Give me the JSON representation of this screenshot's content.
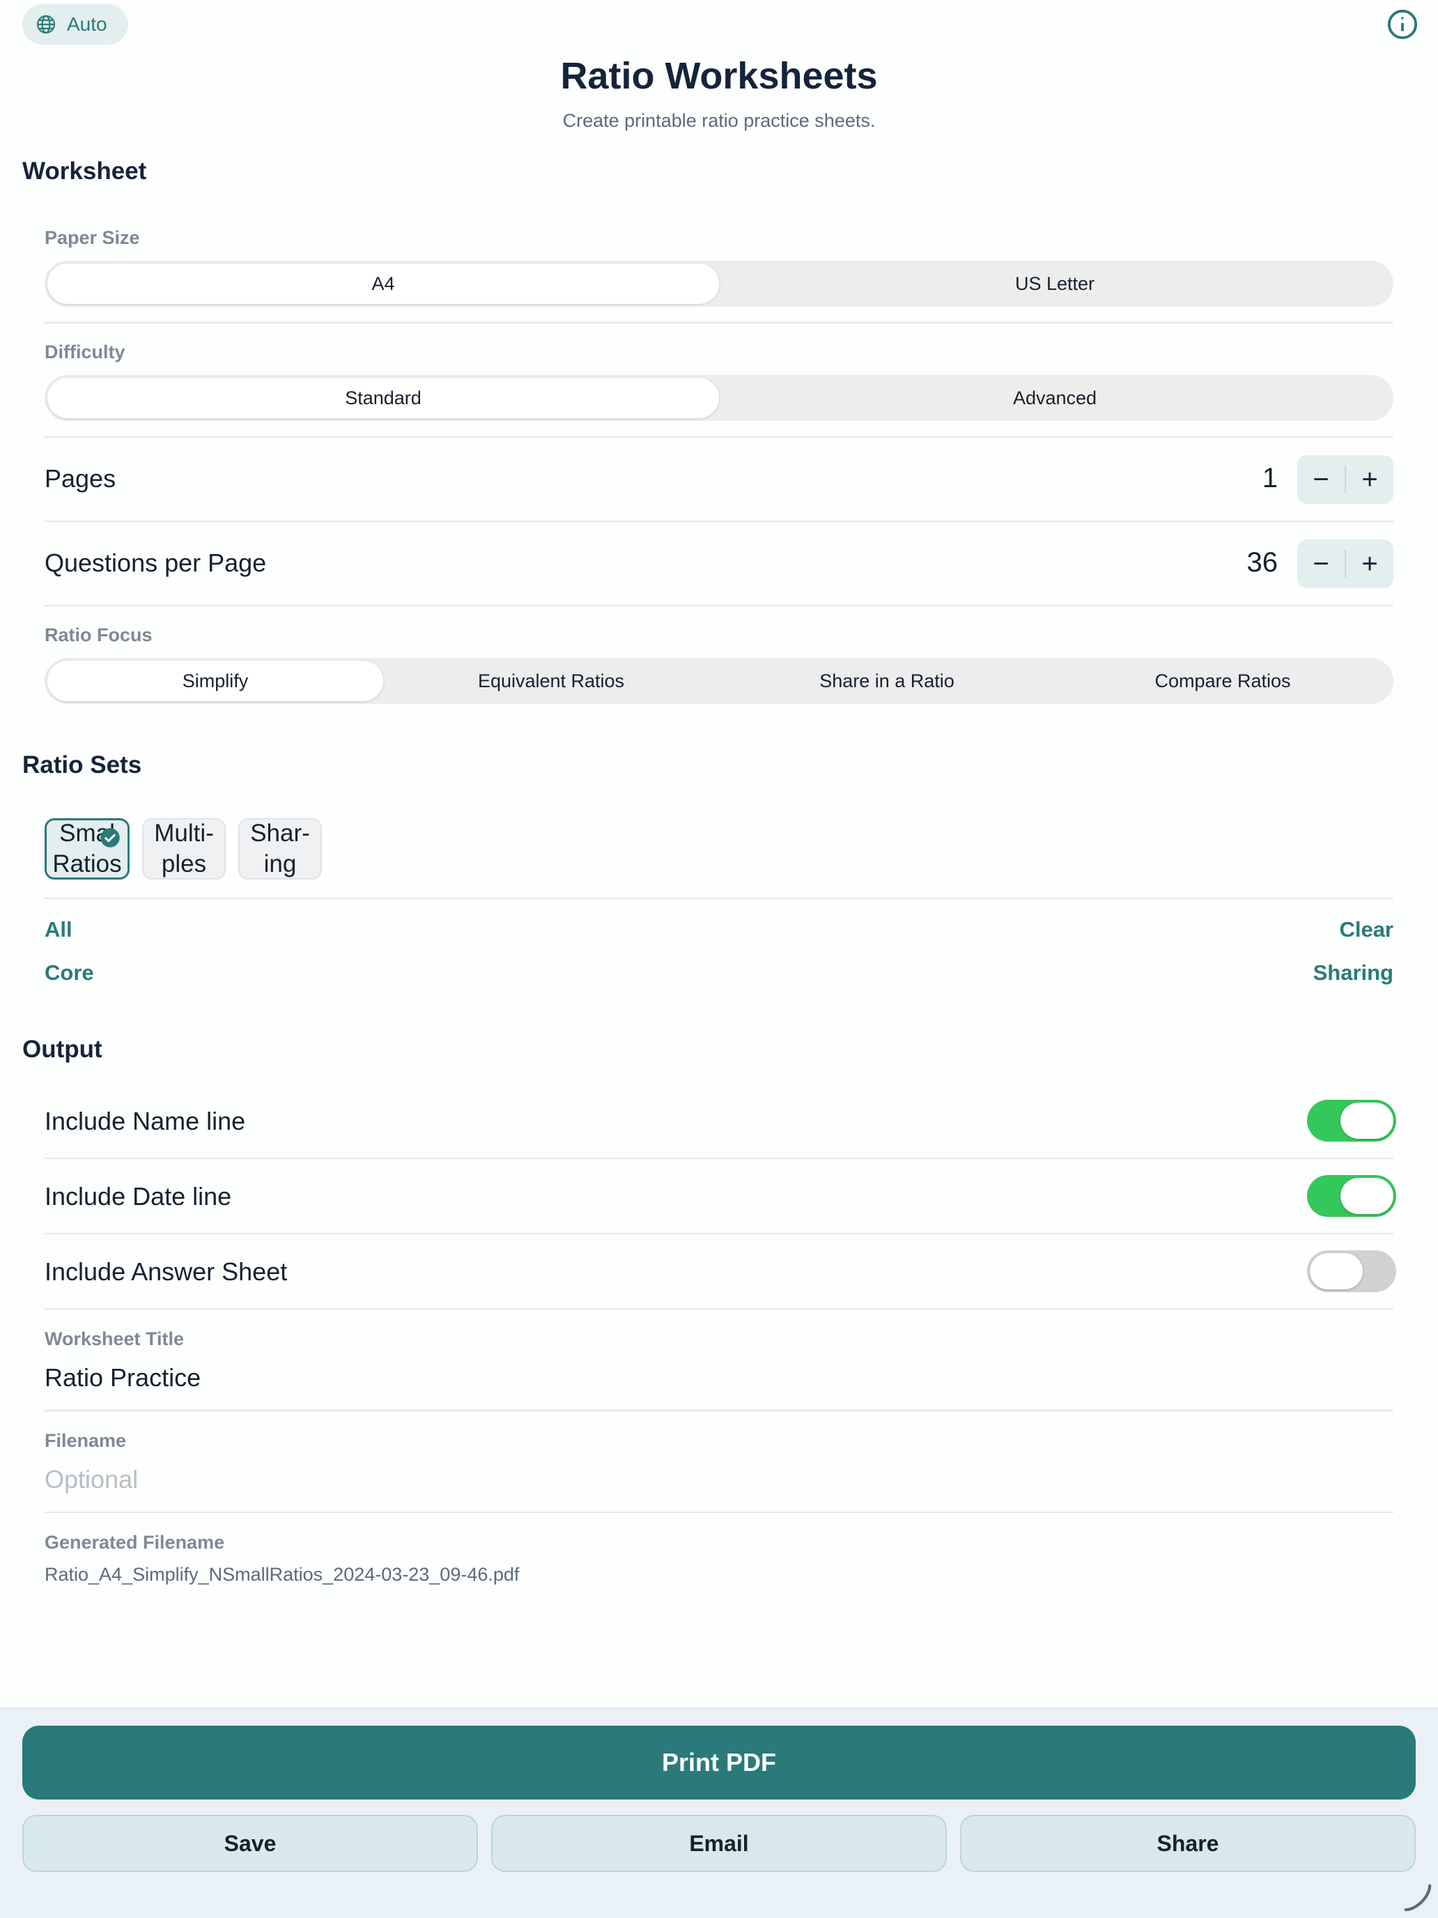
{
  "header": {
    "language_label": "Auto",
    "language_icon": "globe-icon",
    "info_icon": "info-icon",
    "title": "Ratio Worksheets",
    "subtitle": "Create printable ratio practice sheets."
  },
  "worksheet": {
    "heading": "Worksheet",
    "paper_size": {
      "label": "Paper Size",
      "options": [
        "A4",
        "US Letter"
      ],
      "selected": "A4"
    },
    "difficulty": {
      "label": "Difficulty",
      "options": [
        "Standard",
        "Advanced"
      ],
      "selected": "Standard"
    },
    "pages": {
      "label": "Pages",
      "value": "1",
      "minus": "−",
      "plus": "+"
    },
    "questions": {
      "label": "Questions per Page",
      "value": "36",
      "minus": "−",
      "plus": "+"
    },
    "ratio_focus": {
      "label": "Ratio Focus",
      "options": [
        "Simplify",
        "Equivalent Ratios",
        "Share in a Ratio",
        "Compare Ratios"
      ],
      "selected": "Simplify"
    }
  },
  "ratio_sets": {
    "heading": "Ratio Sets",
    "chips": [
      {
        "line1": "Smal",
        "line2": "Ratios",
        "selected": true
      },
      {
        "line1": "Multi-",
        "line2": "ples",
        "selected": false
      },
      {
        "line1": "Shar-",
        "line2": "ing",
        "selected": false
      }
    ],
    "links": {
      "all": "All",
      "clear": "Clear",
      "core": "Core",
      "sharing": "Sharing"
    }
  },
  "output": {
    "heading": "Output",
    "toggles": [
      {
        "label": "Include Name line",
        "on": true
      },
      {
        "label": "Include Date line",
        "on": true
      },
      {
        "label": "Include Answer Sheet",
        "on": false
      }
    ],
    "worksheet_title": {
      "label": "Worksheet Title",
      "value": "Ratio Practice"
    },
    "filename": {
      "label": "Filename",
      "value": "",
      "placeholder": "Optional"
    },
    "generated_filename": {
      "label": "Generated Filename",
      "value": "Ratio_A4_Simplify_NSmallRatios_2024-03-23_09-46.pdf"
    }
  },
  "actions": {
    "print": "Print PDF",
    "save": "Save",
    "email": "Email",
    "share": "Share"
  },
  "colors": {
    "accent": "#2a7a7b",
    "toggle_on": "#34c759",
    "toggle_off": "#d1d1d4",
    "bottom_bar": "#e9f1f6"
  }
}
